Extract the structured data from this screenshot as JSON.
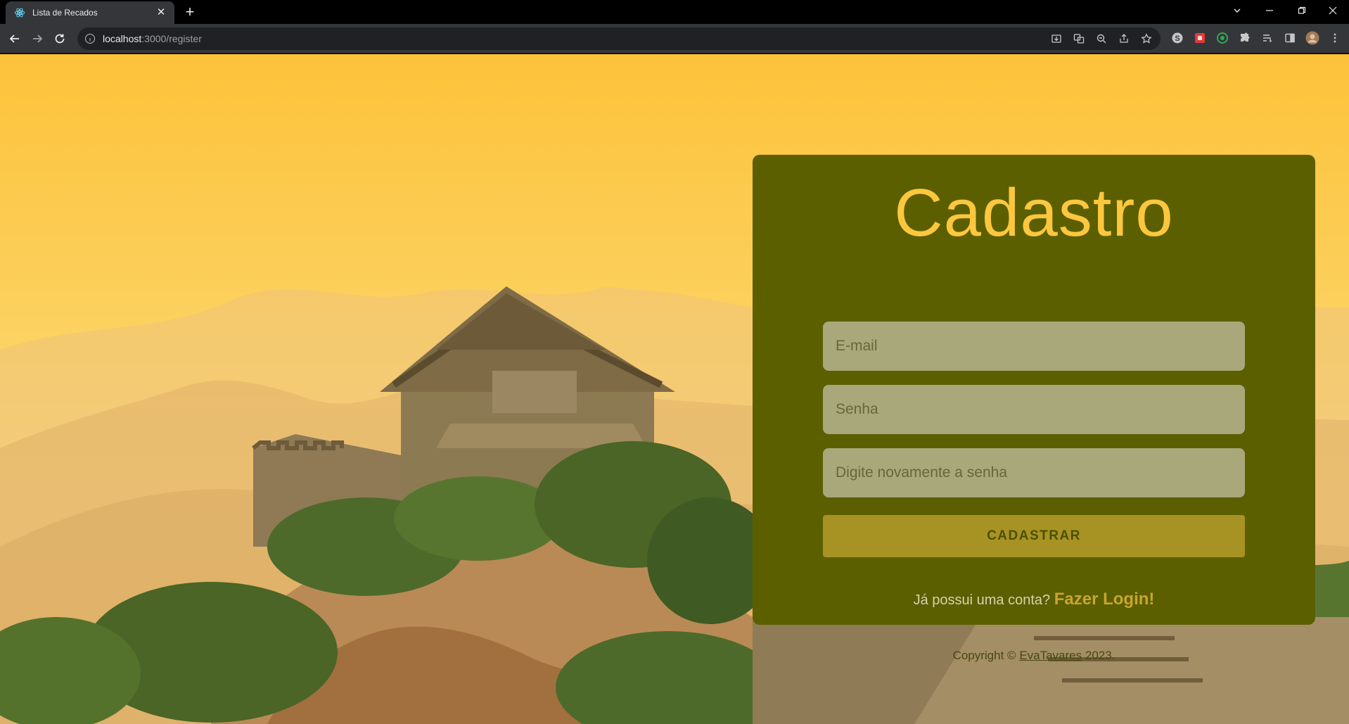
{
  "browser": {
    "tab": {
      "title": "Lista de Recados",
      "favicon": "react-icon"
    },
    "address": {
      "host": "localhost",
      "path": ":3000/register"
    },
    "controls": [
      "chevron-down-icon",
      "minimize-icon",
      "restore-icon",
      "close-icon"
    ]
  },
  "page": {
    "title": "Cadastro",
    "email_placeholder": "E-mail",
    "password_placeholder": "Senha",
    "confirm_placeholder": "Digite novamente a senha",
    "submit_label": "CADASTRAR",
    "login_prompt": "Já possui uma conta?",
    "login_link": "Fazer Login!",
    "copyright_prefix": "Copyright ©",
    "copyright_author": "EvaTavares",
    "copyright_year": "2023."
  },
  "colors": {
    "card": "#5b5f00",
    "title": "#fcc73e",
    "input": "#a8a87a",
    "button": "#a79324",
    "link": "#c8a530"
  }
}
